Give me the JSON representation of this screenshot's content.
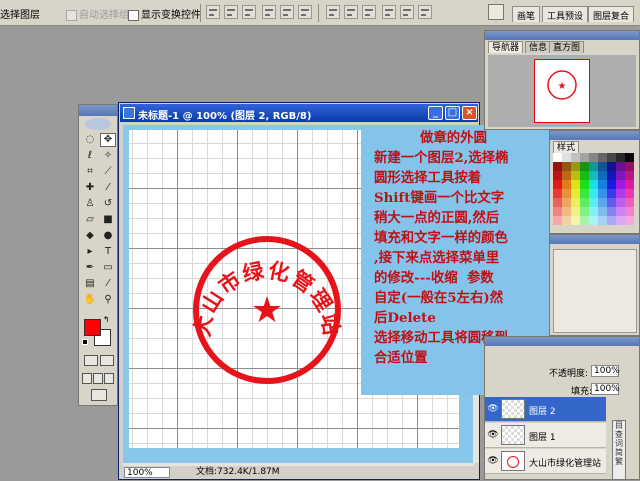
{
  "options_bar": {
    "select_layer_label": "选择图层",
    "auto_select_group_label": "自动选择组",
    "show_transform_label": "显示变换控件"
  },
  "palette_well": {
    "tabs": [
      "画笔",
      "工具预设",
      "图层复合"
    ]
  },
  "document": {
    "title": "未标题-1 @ 100% (图层 2, RGB/8)",
    "zoom": "100%",
    "status": "文档:732.4K/1.87M"
  },
  "stamp": {
    "text": "大山市绿化管理站",
    "center_symbol": "★",
    "color": "#e8131a"
  },
  "note": {
    "title": "做章的外圆",
    "lines": [
      "新建一个图层2,选择椭",
      "圆形选择工具按着",
      "Shift键画一个比文字",
      "稍大一点的正圆,然后",
      "填充和文字一样的颜色",
      ",接下来点选择菜单里",
      "的修改---收缩  参数",
      "自定(一般在5左右)然",
      "后Delete",
      "选择移动工具将圆移到",
      "合适位置"
    ],
    "text_color": "#c01014",
    "background": "#84c4ea"
  },
  "navigator": {
    "tabs": [
      "导航器",
      "信息",
      "直方图"
    ]
  },
  "color_panel": {
    "tab": "样式"
  },
  "layers": {
    "opacity_label": "不透明度:",
    "opacity_value": "100%",
    "fill_label": "填充:",
    "fill_value": "100%",
    "items": [
      {
        "name": "图层 2",
        "selected": true
      },
      {
        "name": "图层 1",
        "selected": false
      },
      {
        "name": "大山市绿化管理站",
        "selected": false
      }
    ],
    "side_labels": [
      "目",
      "查",
      "词",
      "简",
      "繁"
    ]
  },
  "toolbox": {
    "foreground_color": "#ff0000",
    "background_color": "#ffffff",
    "tools": [
      "marquee-tool",
      "move-tool",
      "lasso-tool",
      "magic-wand-tool",
      "crop-tool",
      "slice-tool",
      "healing-tool",
      "brush-tool",
      "stamp-tool",
      "history-brush-tool",
      "eraser-tool",
      "gradient-tool",
      "blur-tool",
      "dodge-tool",
      "path-select-tool",
      "type-tool",
      "pen-tool",
      "shape-tool",
      "notes-tool",
      "eyedropper-tool",
      "hand-tool",
      "zoom-tool"
    ]
  }
}
